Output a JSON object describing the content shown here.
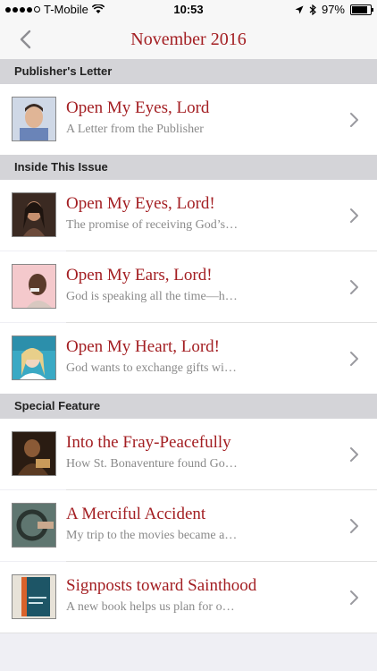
{
  "status": {
    "carrier": "T-Mobile",
    "time": "10:53",
    "battery": "97%",
    "battery_level": 0.97
  },
  "nav": {
    "title": "November 2016"
  },
  "sections": [
    {
      "header": "Publisher's Letter",
      "items": [
        {
          "title": "Open My Eyes, Lord",
          "subtitle": "A Letter from the Publisher"
        }
      ]
    },
    {
      "header": "Inside This Issue",
      "items": [
        {
          "title": "Open My Eyes, Lord!",
          "subtitle": "The promise of receiving God’s…"
        },
        {
          "title": "Open My Ears, Lord!",
          "subtitle": "God is speaking all the time—h…"
        },
        {
          "title": "Open My Heart, Lord!",
          "subtitle": "God wants to exchange gifts wi…"
        }
      ]
    },
    {
      "header": "Special Feature",
      "items": [
        {
          "title": "Into the Fray-Peacefully",
          "subtitle": "How St. Bonaventure found Go…"
        },
        {
          "title": "A Merciful Accident",
          "subtitle": "My trip to the movies became a…"
        },
        {
          "title": "Signposts toward Sainthood",
          "subtitle": "A new book helps us plan for o…"
        }
      ]
    }
  ]
}
